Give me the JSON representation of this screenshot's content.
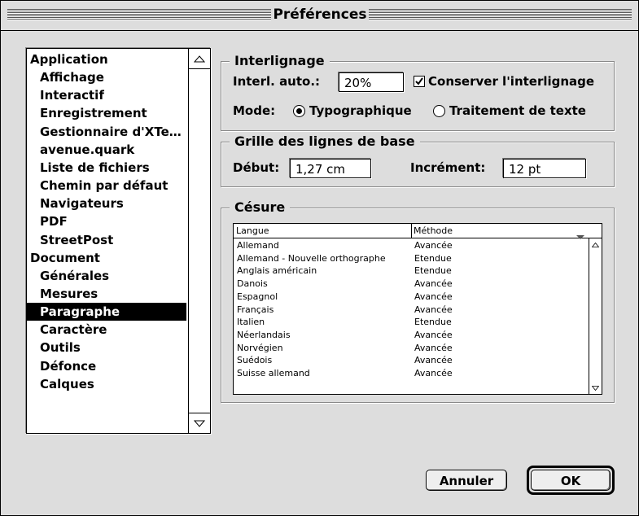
{
  "window": {
    "title": "Préférences"
  },
  "categories": [
    {
      "label": "Application",
      "level": 0,
      "selected": false
    },
    {
      "label": "Affichage",
      "level": 1,
      "selected": false
    },
    {
      "label": "Interactif",
      "level": 1,
      "selected": false
    },
    {
      "label": "Enregistrement",
      "level": 1,
      "selected": false
    },
    {
      "label": "Gestionnaire d'XTe…",
      "level": 1,
      "selected": false
    },
    {
      "label": "avenue.quark",
      "level": 1,
      "selected": false
    },
    {
      "label": "Liste de fichiers",
      "level": 1,
      "selected": false
    },
    {
      "label": "Chemin par défaut",
      "level": 1,
      "selected": false
    },
    {
      "label": "Navigateurs",
      "level": 1,
      "selected": false
    },
    {
      "label": "PDF",
      "level": 1,
      "selected": false
    },
    {
      "label": "StreetPost",
      "level": 1,
      "selected": false
    },
    {
      "label": "Document",
      "level": 0,
      "selected": false
    },
    {
      "label": "Générales",
      "level": 1,
      "selected": false
    },
    {
      "label": "Mesures",
      "level": 1,
      "selected": false
    },
    {
      "label": "Paragraphe",
      "level": 1,
      "selected": true
    },
    {
      "label": "Caractère",
      "level": 1,
      "selected": false
    },
    {
      "label": "Outils",
      "level": 1,
      "selected": false
    },
    {
      "label": "Défonce",
      "level": 1,
      "selected": false
    },
    {
      "label": "Calques",
      "level": 1,
      "selected": false
    }
  ],
  "leading": {
    "group_title": "Interlignage",
    "auto_label": "Interl. auto.:",
    "auto_value": "20%",
    "maintain_checked": true,
    "maintain_label": "Conserver l'interlignage",
    "mode_label": "Mode:",
    "mode_options": [
      "Typographique",
      "Traitement de texte"
    ],
    "mode_selected": "Typographique"
  },
  "baseline_grid": {
    "group_title": "Grille des lignes de base",
    "start_label": "Début:",
    "start_value": "1,27 cm",
    "increment_label": "Incrément:",
    "increment_value": "12 pt"
  },
  "hyphenation": {
    "group_title": "Césure",
    "columns": [
      "Langue",
      "Méthode"
    ],
    "rows": [
      [
        "Allemand",
        "Avancée"
      ],
      [
        "Allemand - Nouvelle orthographe",
        "Etendue"
      ],
      [
        "Anglais américain",
        "Etendue"
      ],
      [
        "Danois",
        "Avancée"
      ],
      [
        "Espagnol",
        "Avancée"
      ],
      [
        "Français",
        "Avancée"
      ],
      [
        "Italien",
        "Etendue"
      ],
      [
        "Néerlandais",
        "Avancée"
      ],
      [
        "Norvégien",
        "Avancée"
      ],
      [
        "Suédois",
        "Avancée"
      ],
      [
        "Suisse allemand",
        "Avancée"
      ]
    ]
  },
  "buttons": {
    "cancel": "Annuler",
    "ok": "OK"
  }
}
